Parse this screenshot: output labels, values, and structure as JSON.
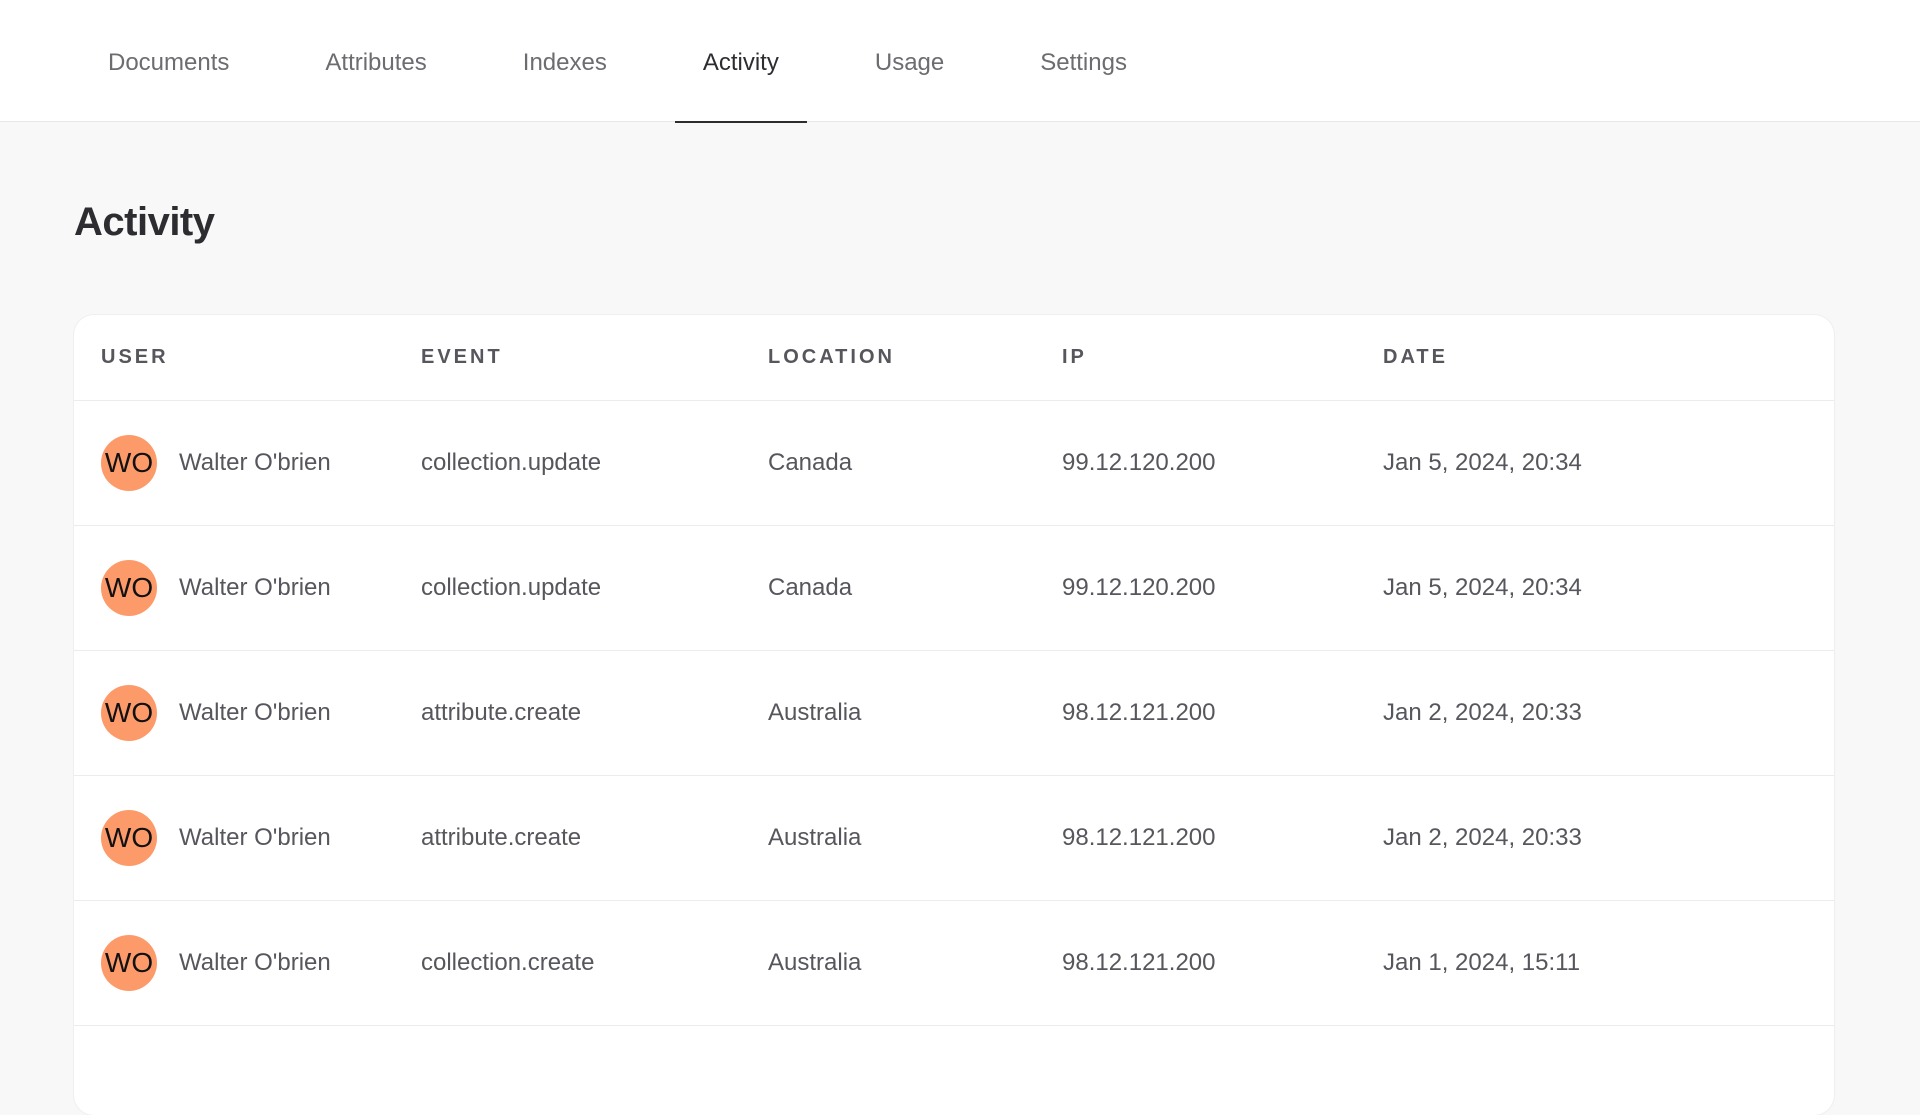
{
  "tabs": [
    {
      "label": "Documents",
      "active": false
    },
    {
      "label": "Attributes",
      "active": false
    },
    {
      "label": "Indexes",
      "active": false
    },
    {
      "label": "Activity",
      "active": true
    },
    {
      "label": "Usage",
      "active": false
    },
    {
      "label": "Settings",
      "active": false
    }
  ],
  "page": {
    "title": "Activity"
  },
  "table": {
    "columns": [
      "USER",
      "EVENT",
      "LOCATION",
      "IP",
      "DATE"
    ],
    "rows": [
      {
        "initials": "WO",
        "user": "Walter O'brien",
        "event": "collection.update",
        "location": "Canada",
        "ip": "99.12.120.200",
        "date": "Jan 5, 2024, 20:34"
      },
      {
        "initials": "WO",
        "user": "Walter O'brien",
        "event": "collection.update",
        "location": "Canada",
        "ip": "99.12.120.200",
        "date": "Jan 5, 2024, 20:34"
      },
      {
        "initials": "WO",
        "user": "Walter O'brien",
        "event": "attribute.create",
        "location": "Australia",
        "ip": "98.12.121.200",
        "date": "Jan 2, 2024, 20:33"
      },
      {
        "initials": "WO",
        "user": "Walter O'brien",
        "event": "attribute.create",
        "location": "Australia",
        "ip": "98.12.121.200",
        "date": "Jan 2, 2024, 20:33"
      },
      {
        "initials": "WO",
        "user": "Walter O'brien",
        "event": "collection.create",
        "location": "Australia",
        "ip": "98.12.121.200",
        "date": "Jan 1, 2024, 15:11"
      }
    ]
  },
  "colors": {
    "avatar_bg": "#fd9a6a",
    "active_tab_underline": "#2d2d31"
  }
}
